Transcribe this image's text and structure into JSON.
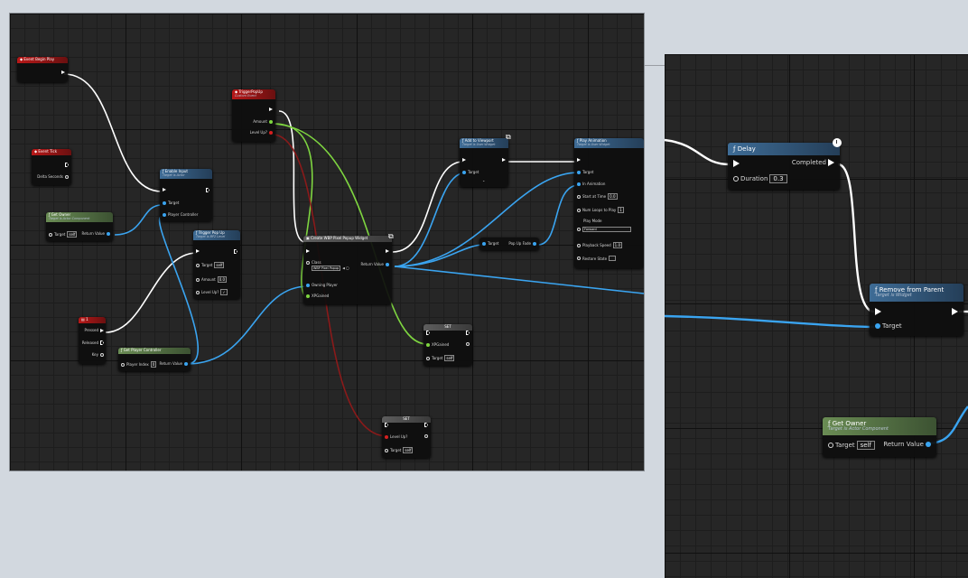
{
  "panel1": {
    "event_begin_play": {
      "title": "Event Begin Play"
    },
    "event_tick": {
      "title": "Event Tick",
      "delta_seconds": "Delta Seconds"
    },
    "get_owner": {
      "title": "Get Owner",
      "subtitle": "Target is Actor Component",
      "target": "Target",
      "target_value": "self",
      "return_value": "Return Value"
    },
    "enable_input": {
      "title": "Enable Input",
      "subtitle": "Target is Actor",
      "target": "Target",
      "player_controller": "Player Controller"
    },
    "trigger_popup": {
      "title": "TriggerPopUp",
      "subtitle": "Custom Event",
      "amount": "Amount",
      "level_up": "Level Up?"
    },
    "trigger_pop_up": {
      "title": "Trigger Pop Up",
      "subtitle": "Target is BP2 Level",
      "target": "Target",
      "target_value": "self",
      "amount": "Amount",
      "amount_value": "0.0",
      "level_up": "Level Up?"
    },
    "key_event": {
      "title": "1",
      "pressed": "Pressed",
      "released": "Released",
      "key": "Key"
    },
    "get_player_controller": {
      "title": "Get Player Controller",
      "player_index": "Player Index",
      "player_index_value": "0",
      "return_value": "Return Value"
    },
    "create_widget": {
      "title": "Create WBP Pixel Popup Widget",
      "class": "Class",
      "class_value": "WBP Pixel Popup",
      "owning_player": "Owning Player",
      "xp_gained": "XPGained",
      "return_value": "Return Value"
    },
    "add_to_viewport": {
      "title": "Add to Viewport",
      "subtitle": "Target is User Widget",
      "target": "Target",
      "expand": "⌄"
    },
    "play_animation": {
      "title": "Play Animation",
      "subtitle": "Target is User Widget",
      "target": "Target",
      "in_animation": "In Animation",
      "start_at_time": "Start at Time",
      "start_at_time_value": "0.0",
      "num_loops": "Num Loops to Play",
      "num_loops_value": "1",
      "play_mode": "Play Mode",
      "play_mode_value": "Forward",
      "playback_speed": "Playback Speed",
      "playback_speed_value": "1.0",
      "restore_state": "Restore State"
    },
    "popup_fade": {
      "target": "Target",
      "output": "Pop Up Fade"
    },
    "set_xp": {
      "title": "SET",
      "xp_gained": "XPGained",
      "target": "Target",
      "target_value": "self"
    },
    "set_level": {
      "title": "SET",
      "level_up": "Level Up?",
      "target": "Target",
      "target_value": "self"
    }
  },
  "panel2": {
    "delay": {
      "title": "Delay",
      "duration": "Duration",
      "duration_value": "0.3",
      "completed": "Completed"
    },
    "remove_from_parent": {
      "title": "Remove from Parent",
      "subtitle": "Target is Widget",
      "target": "Target"
    },
    "get_owner": {
      "title": "Get Owner",
      "subtitle": "Target is Actor Component",
      "target": "Target",
      "target_value": "self",
      "return_value": "Return Value"
    }
  },
  "colors": {
    "exec": "#ffffff",
    "object": "#3aa4f0",
    "float": "#7ed540",
    "bool": "#d62020",
    "event": "#b81818",
    "function": "#3e6c96",
    "pure": "#6a8c54"
  }
}
